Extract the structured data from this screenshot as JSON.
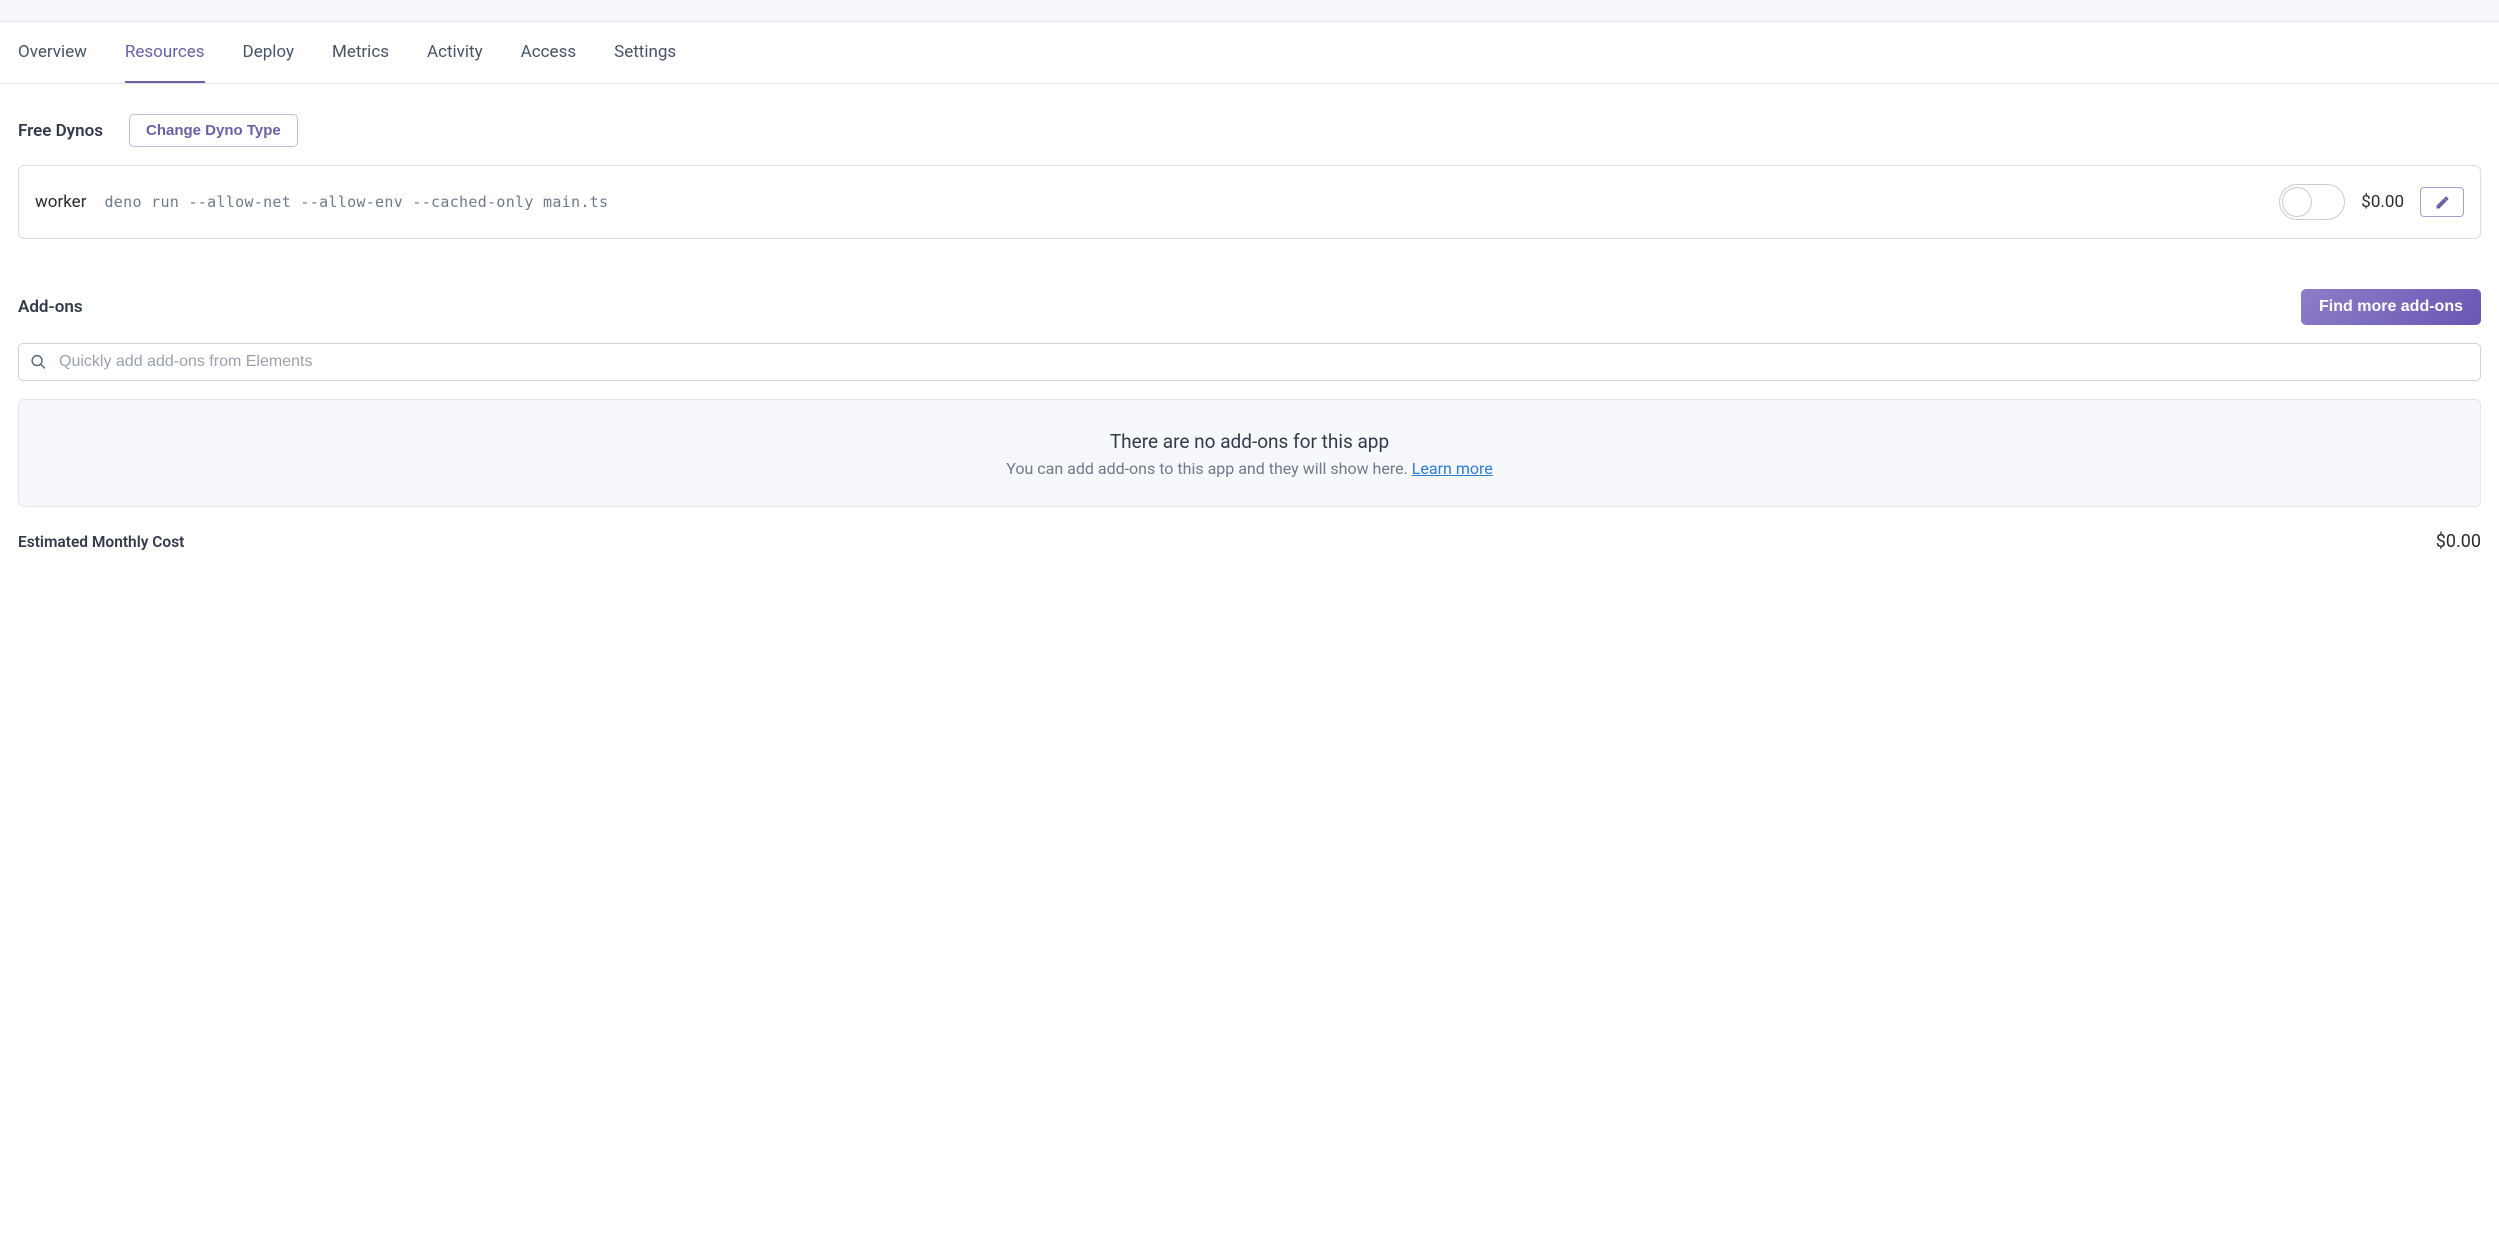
{
  "tabs": [
    {
      "label": "Overview"
    },
    {
      "label": "Resources"
    },
    {
      "label": "Deploy"
    },
    {
      "label": "Metrics"
    },
    {
      "label": "Activity"
    },
    {
      "label": "Access"
    },
    {
      "label": "Settings"
    }
  ],
  "dynos": {
    "section_title": "Free Dynos",
    "change_btn": "Change Dyno Type",
    "row": {
      "type": "worker",
      "command": "deno run --allow-net --allow-env --cached-only main.ts",
      "cost": "$0.00"
    }
  },
  "addons": {
    "section_title": "Add-ons",
    "find_btn": "Find more add-ons",
    "search_placeholder": "Quickly add add-ons from Elements",
    "empty_title": "There are no add-ons for this app",
    "empty_sub_prefix": "You can add add-ons to this app and they will show here. ",
    "empty_link": "Learn more"
  },
  "cost": {
    "label": "Estimated Monthly Cost",
    "value": "$0.00"
  }
}
